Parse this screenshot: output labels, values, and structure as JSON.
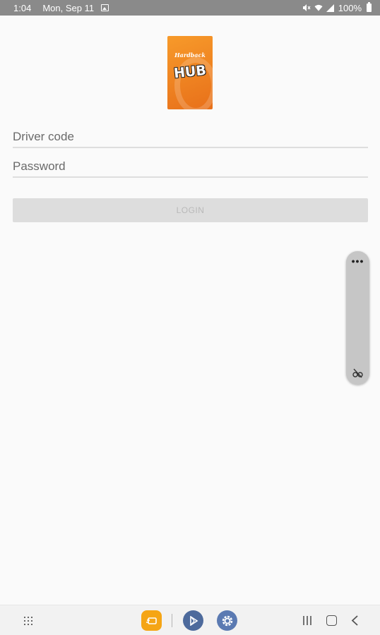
{
  "status_bar": {
    "time": "1:04",
    "date": "Mon, Sep 11",
    "battery": "100%",
    "icons": [
      "gallery-icon",
      "mute-icon",
      "wifi-icon",
      "signal-icon",
      "battery-icon"
    ]
  },
  "logo": {
    "brand_script": "Hardback",
    "hub_text": "HUB",
    "color": "#f08a22"
  },
  "form": {
    "driver_code_placeholder": "Driver code",
    "driver_code_value": "",
    "password_placeholder": "Password",
    "password_value": "",
    "login_label": "LOGIN"
  },
  "float_panel": {
    "more_label": "•••",
    "icons": [
      "more-icon",
      "glasses-off-icon"
    ]
  },
  "nav_bar": {
    "icons": [
      "apps-grid-icon",
      "orange-app-icon",
      "play-store-icon",
      "settings-icon",
      "recents-icon",
      "home-icon",
      "back-icon"
    ],
    "accent": "#f5a515"
  }
}
